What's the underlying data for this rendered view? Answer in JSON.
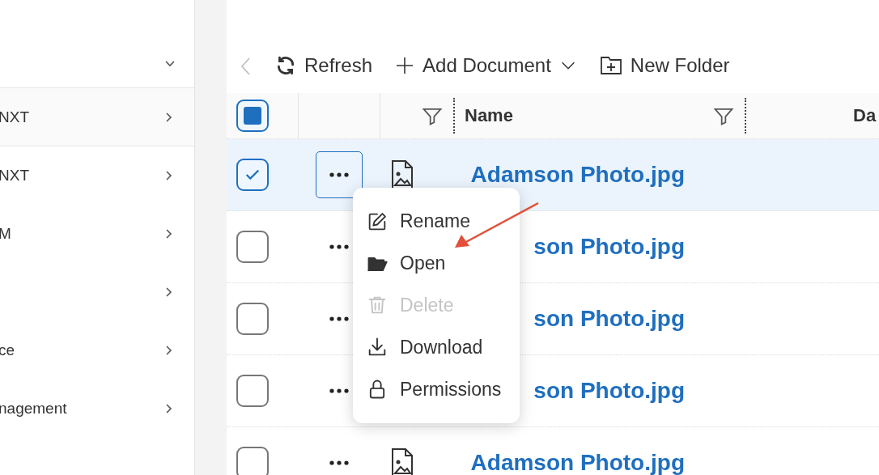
{
  "sidebar": {
    "expanded": true,
    "items": [
      {
        "label": "NXT",
        "selected": true
      },
      {
        "label": "NXT",
        "selected": false
      },
      {
        "label": "M",
        "selected": false
      },
      {
        "selected": false
      },
      {
        "label": "ce",
        "selected": false
      },
      {
        "label": "nagement",
        "selected": false
      }
    ]
  },
  "toolbar": {
    "back_disabled": true,
    "refresh": "Refresh",
    "add_document": "Add Document",
    "new_folder": "New Folder"
  },
  "table": {
    "select_all_indeterminate": true,
    "columns": [
      {
        "label": "Name"
      },
      {
        "label": "Da"
      }
    ],
    "rows": [
      {
        "name": "Adamson Photo.jpg",
        "selected": true,
        "menu_open": true,
        "file_icon": true
      },
      {
        "name": "son Photo.jpg",
        "selected": false,
        "menu_open": false
      },
      {
        "name": "son Photo.jpg",
        "selected": false,
        "menu_open": false
      },
      {
        "name": "son Photo.jpg",
        "selected": false,
        "menu_open": false
      },
      {
        "name": "Adamson Photo.jpg",
        "selected": false,
        "menu_open": false,
        "file_icon": true
      }
    ]
  },
  "context_menu": {
    "items": [
      {
        "label": "Rename",
        "disabled": false
      },
      {
        "label": "Open",
        "disabled": false
      },
      {
        "label": "Delete",
        "disabled": true
      },
      {
        "label": "Download",
        "disabled": false
      },
      {
        "label": "Permissions",
        "disabled": false
      }
    ]
  }
}
